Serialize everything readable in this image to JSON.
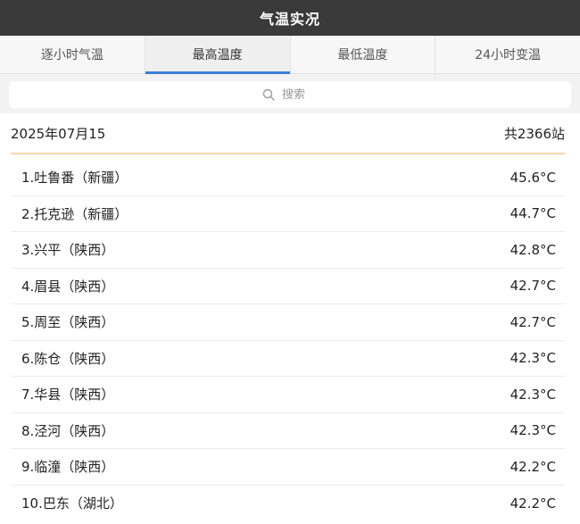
{
  "header": {
    "title": "气温实况"
  },
  "tabs": [
    {
      "label": "逐小时气温",
      "active": false
    },
    {
      "label": "最高温度",
      "active": true
    },
    {
      "label": "最低温度",
      "active": false
    },
    {
      "label": "24小时变温",
      "active": false
    }
  ],
  "search": {
    "placeholder": "搜索",
    "icon": "search-icon"
  },
  "summary": {
    "date": "2025年07月15",
    "count": "共2366站"
  },
  "colors": {
    "accent": "#3d7fd6",
    "header_bg": "#3a3a3a",
    "divider": "#f3d8a8"
  },
  "stations": [
    {
      "name": "1.吐鲁番（新疆）",
      "temp": "45.6°C"
    },
    {
      "name": "2.托克逊（新疆）",
      "temp": "44.7°C"
    },
    {
      "name": "3.兴平（陕西）",
      "temp": "42.8°C"
    },
    {
      "name": "4.眉县（陕西）",
      "temp": "42.7°C"
    },
    {
      "name": "5.周至（陕西）",
      "temp": "42.7°C"
    },
    {
      "name": "6.陈仓（陕西）",
      "temp": "42.3°C"
    },
    {
      "name": "7.华县（陕西）",
      "temp": "42.3°C"
    },
    {
      "name": "8.泾河（陕西）",
      "temp": "42.3°C"
    },
    {
      "name": "9.临潼（陕西）",
      "temp": "42.2°C"
    },
    {
      "name": "10.巴东（湖北）",
      "temp": "42.2°C"
    }
  ]
}
